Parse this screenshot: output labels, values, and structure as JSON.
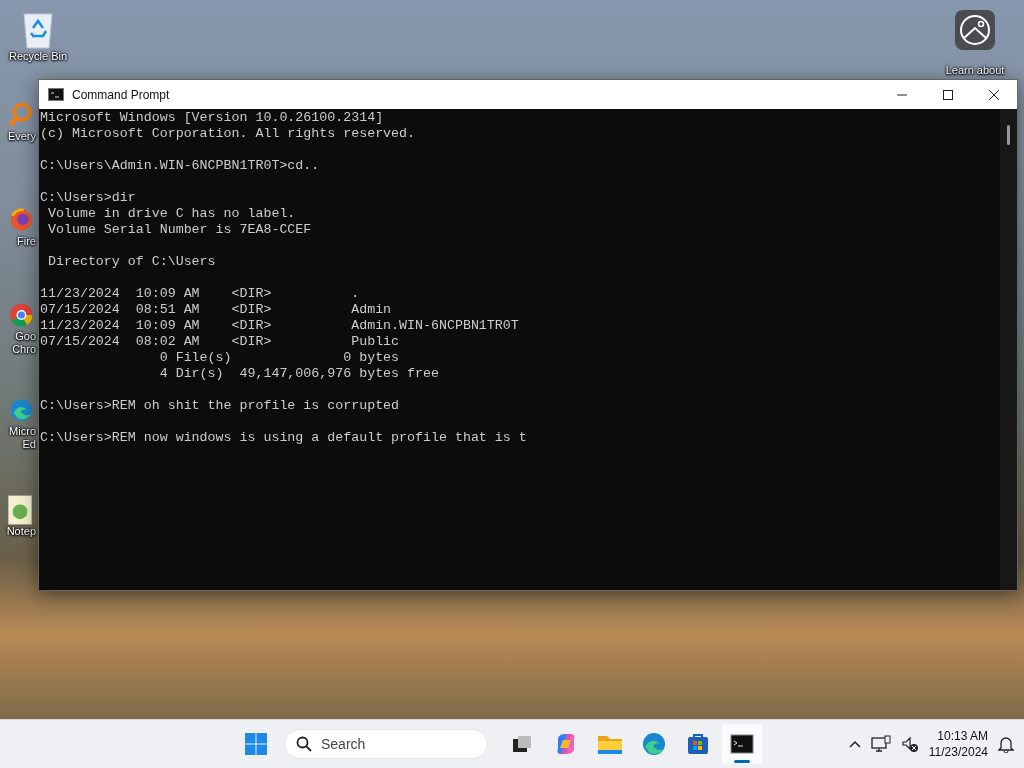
{
  "desktop": {
    "icons": [
      {
        "kind": "recycle-bin",
        "label": [
          "Recycle Bin"
        ]
      },
      {
        "kind": "search-app",
        "label": [
          "Every"
        ]
      },
      {
        "kind": "firefox",
        "label": [
          "Fire"
        ]
      },
      {
        "kind": "chrome",
        "label": [
          "Goo",
          "Chro"
        ]
      },
      {
        "kind": "edge",
        "label": [
          "Micro",
          "Ed"
        ]
      },
      {
        "kind": "notepad",
        "label": [
          "Notep"
        ]
      }
    ],
    "right_icon": {
      "kind": "learn",
      "label": [
        "Learn about"
      ]
    }
  },
  "window": {
    "title": "Command Prompt",
    "console": [
      [
        "Microsoft Windows [Version 10.0.26100.2314]",
        "(c) Microsoft Corporation. All rights reserved."
      ],
      [
        "C:\\Users\\Admin.WIN-6NCPBN1TR0T>cd.."
      ],
      [
        "C:\\Users>dir",
        " Volume in drive C has no label.",
        " Volume Serial Number is 7EA8-CCEF"
      ],
      [
        " Directory of C:\\Users"
      ],
      [
        "11/23/2024  10:09 AM    <DIR>          .",
        "07/15/2024  08:51 AM    <DIR>          Admin",
        "11/23/2024  10:09 AM    <DIR>          Admin.WIN-6NCPBN1TR0T",
        "07/15/2024  08:02 AM    <DIR>          Public",
        "               0 File(s)              0 bytes",
        "               4 Dir(s)  49,147,006,976 bytes free"
      ],
      [
        "C:\\Users>REM oh shit the profile is corrupted"
      ],
      [
        "C:\\Users>REM now windows is using a default profile that is t"
      ]
    ]
  },
  "taskbar": {
    "search": {
      "placeholder": "Search"
    },
    "apps": [
      {
        "kind": "task-view",
        "selected": false
      },
      {
        "kind": "copilot",
        "selected": false
      },
      {
        "kind": "folder",
        "selected": false
      },
      {
        "kind": "edge",
        "selected": false
      },
      {
        "kind": "store",
        "selected": false
      },
      {
        "kind": "terminal",
        "selected": true
      }
    ],
    "clock": {
      "time": "10:13 AM",
      "date": "11/23/2024"
    }
  }
}
